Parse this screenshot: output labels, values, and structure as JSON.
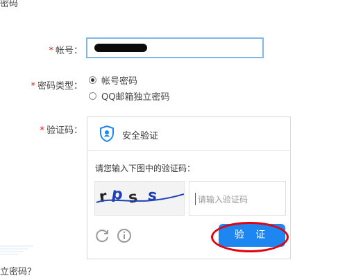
{
  "page": {
    "top_cut_text": "密码",
    "bottom_cut_text": "立密码？"
  },
  "account": {
    "label": "帐号：",
    "required_mark": "*",
    "value_masked": true
  },
  "password_type": {
    "label": "密码类型：",
    "required_mark": "*",
    "options": [
      {
        "label": "帐号密码",
        "checked": true
      },
      {
        "label": "QQ邮箱独立密码",
        "checked": false
      }
    ]
  },
  "captcha": {
    "label": "验证码：",
    "required_mark": "*",
    "panel_title": "安全验证",
    "prompt": "请您输入下图中的验证码：",
    "code_input_placeholder": "请输入验证码",
    "image_text": "rpss",
    "verify_button": "验 证",
    "accent_color": "#1d86f0",
    "highlight_color": "#e3000f",
    "icons": [
      "shield-icon",
      "refresh-icon",
      "info-icon"
    ]
  }
}
